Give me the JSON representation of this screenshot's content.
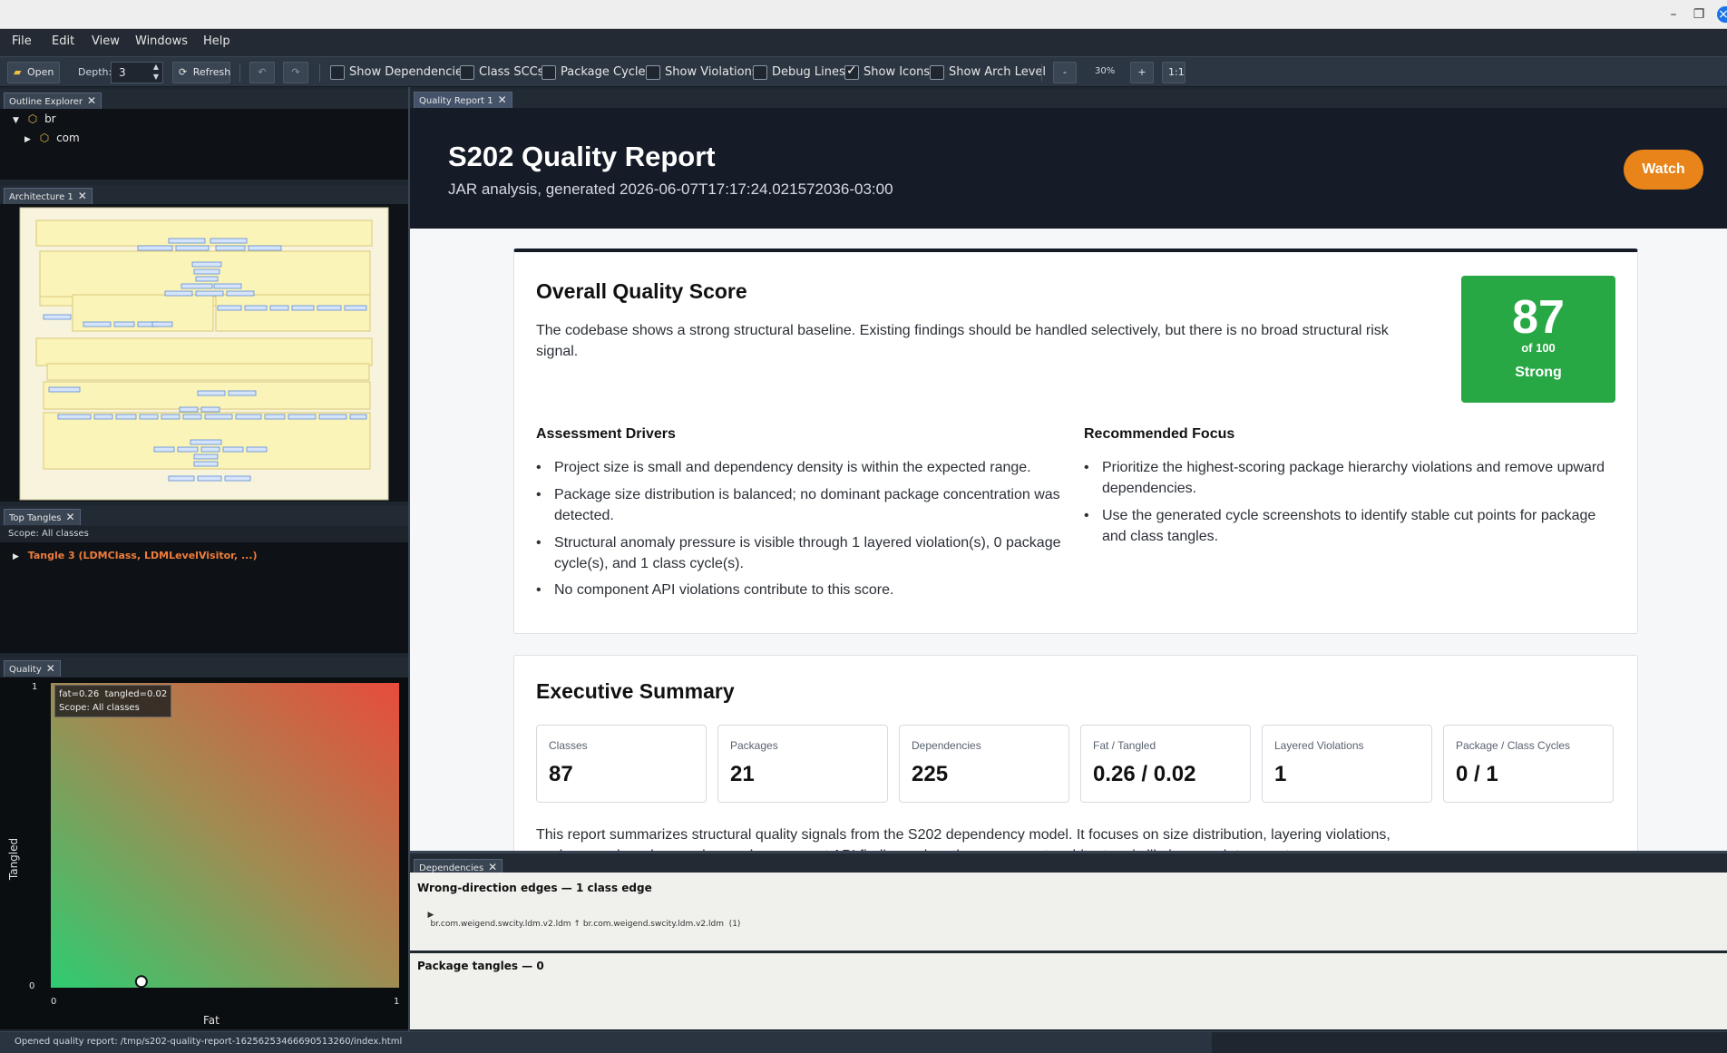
{
  "menu": [
    "File",
    "Edit",
    "View",
    "Windows",
    "Help"
  ],
  "toolbar": {
    "open_label": "Open",
    "depth_label": "Depth:",
    "depth_value": "3",
    "refresh_label": "Refresh",
    "checks": [
      {
        "label": "Show Dependencies",
        "checked": false
      },
      {
        "label": "Class SCCs",
        "checked": false
      },
      {
        "label": "Package Cycles",
        "checked": false
      },
      {
        "label": "Show Violations",
        "checked": false
      },
      {
        "label": "Debug Lines",
        "checked": false
      },
      {
        "label": "Show Icons",
        "checked": true
      },
      {
        "label": "Show Arch Level",
        "checked": false
      }
    ],
    "zoom_out": "-",
    "zoom_value": "30%",
    "zoom_in": "+",
    "zoom_reset": "1:1"
  },
  "outline": {
    "tab": "Outline Explorer",
    "items": [
      "br",
      "com"
    ]
  },
  "architecture": {
    "tab": "Architecture 1"
  },
  "tangles": {
    "tab": "Top Tangles",
    "scope": "Scope: All classes",
    "item": "Tangle 3 (LDMClass, LDMLevelVisitor, ...)"
  },
  "quality_panel": {
    "tab": "Quality",
    "tooltip_line1": "fat=0.26  tangled=0.02",
    "tooltip_line2": "Scope: All classes",
    "ylabel": "Tangled",
    "xlabel": "Fat",
    "y_top": "1",
    "y_bottom": "0",
    "x_left": "0",
    "x_right": "1"
  },
  "chart_data": {
    "type": "scatter",
    "xlabel": "Fat",
    "ylabel": "Tangled",
    "xlim": [
      0,
      1
    ],
    "ylim": [
      0,
      1
    ],
    "points": [
      {
        "x": 0.26,
        "y": 0.02
      }
    ]
  },
  "report": {
    "tab": "Quality Report 1",
    "title": "S202 Quality Report",
    "subtitle": "JAR analysis, generated 2026-06-07T17:17:24.021572036-03:00",
    "watch_label": "Watch",
    "overall": {
      "heading": "Overall Quality Score",
      "text": "The codebase shows a strong structural baseline. Existing findings should be handled selectively, but there is no broad structural risk signal.",
      "score": "87",
      "of": "of 100",
      "rating": "Strong",
      "score_color": "#28a745"
    },
    "drivers": {
      "heading": "Assessment Drivers",
      "items": [
        "Project size is small and dependency density is within the expected range.",
        "Package size distribution is balanced; no dominant package concentration was detected.",
        "Structural anomaly pressure is visible through 1 layered violation(s), 0 package cycle(s), and 1 class cycle(s).",
        "No component API violations contribute to this score."
      ]
    },
    "focus": {
      "heading": "Recommended Focus",
      "items": [
        "Prioritize the highest-scoring package hierarchy violations and remove upward dependencies.",
        "Use the generated cycle screenshots to identify stable cut points for package and class tangles."
      ]
    },
    "executive": {
      "heading": "Executive Summary",
      "metrics": [
        {
          "label": "Classes",
          "value": "87"
        },
        {
          "label": "Packages",
          "value": "21"
        },
        {
          "label": "Dependencies",
          "value": "225"
        },
        {
          "label": "Fat / Tangled",
          "value": "0.26 / 0.02"
        },
        {
          "label": "Layered Violations",
          "value": "1"
        },
        {
          "label": "Package / Class Cycles",
          "value": "0 / 1"
        }
      ],
      "text": "This report summarizes structural quality signals from the S202 dependency model. It focuses on size distribution, layering violations, package cycles, class cycles, and component API findings when the component architecture is likely enough to report."
    }
  },
  "dependencies": {
    "tab": "Dependencies",
    "wrong_heading": "Wrong-direction edges — 1 class edge",
    "wrong_item": "br.com.weigend.swcity.ldm.v2.ldm ↑ br.com.weigend.swcity.ldm.v2.ldm  (1)",
    "tangles_heading": "Package tangles — 0"
  },
  "status": "Opened quality report: /tmp/s202-quality-report-16256253466690513260/index.html",
  "colors": {
    "accent_orange": "#e8841a",
    "tangle_orange": "#f07d3c"
  }
}
